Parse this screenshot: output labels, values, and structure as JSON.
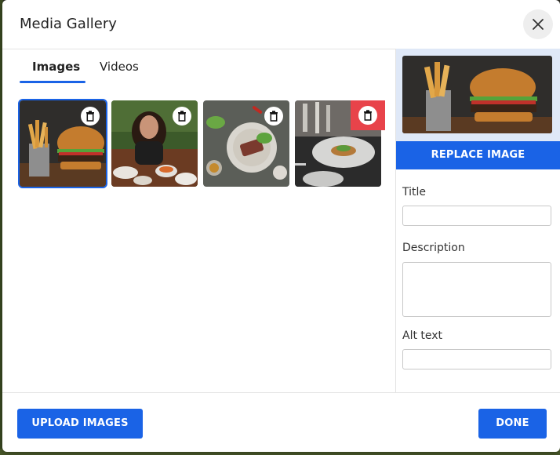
{
  "dialog": {
    "title": "Media Gallery"
  },
  "tabs": [
    {
      "label": "Images",
      "active": true
    },
    {
      "label": "Videos",
      "active": false
    }
  ],
  "images": [
    {
      "subject": "burger with fries",
      "selected": true
    },
    {
      "subject": "woman dining"
    },
    {
      "subject": "plated steak with greens"
    },
    {
      "subject": "restaurant table setting"
    }
  ],
  "details": {
    "replace_label": "REPLACE IMAGE",
    "title_label": "Title",
    "title_value": "",
    "description_label": "Description",
    "description_value": "",
    "alt_label": "Alt text",
    "alt_value": ""
  },
  "footer": {
    "upload_label": "UPLOAD IMAGES",
    "done_label": "DONE"
  },
  "colors": {
    "accent": "#1a63e6",
    "highlight": "#e8434a"
  },
  "icons": {
    "close": "close-icon",
    "delete": "trash-icon"
  }
}
